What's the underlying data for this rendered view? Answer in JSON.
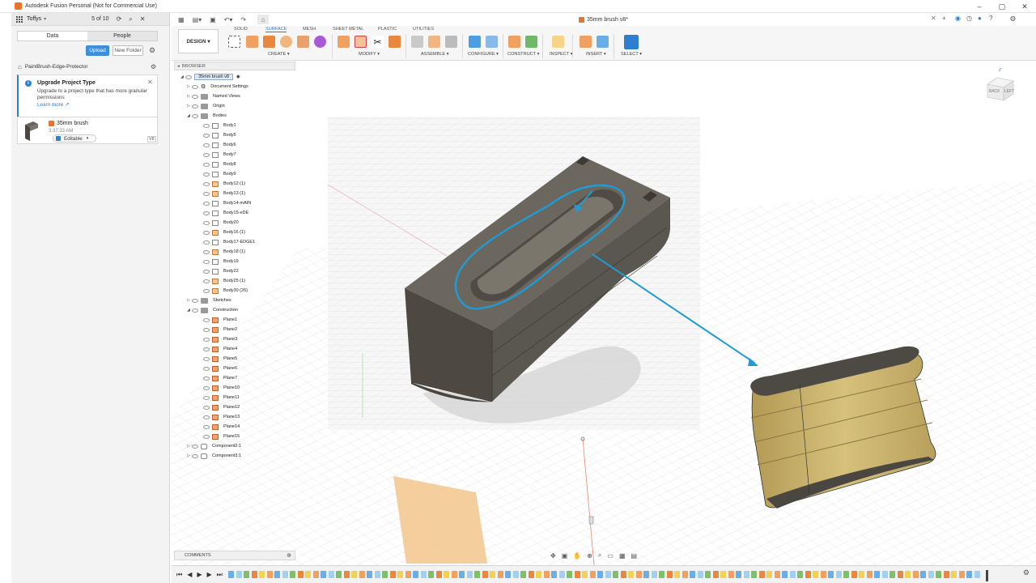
{
  "window": {
    "title": "Autodesk Fusion Personal (Not for Commercial Use)",
    "document_tab": "35mm brush v8*"
  },
  "data_panel": {
    "team": "Toffys",
    "counter": "5 of 10",
    "tabs": [
      "Data",
      "People"
    ],
    "upload_label": "Upload",
    "new_folder_label": "New Folder",
    "breadcrumb": "PaintBrush-Edge-Protector",
    "notice": {
      "title": "Upgrade Project Type",
      "body": "Upgrade to a project type that has more granular permissions",
      "link": "Learn more"
    },
    "file": {
      "name": "35mm brush",
      "time": "3:37:33 AM",
      "status": "Editable",
      "version": "V8"
    }
  },
  "toolbar": {
    "design_label": "DESIGN",
    "workspace_tabs": [
      "SOLID",
      "SURFACE",
      "MESH",
      "SHEET METAL",
      "PLASTIC",
      "UTILITIES"
    ],
    "active_tab": "SURFACE",
    "groups": [
      "CREATE",
      "MODIFY",
      "ASSEMBLE",
      "CONFIGURE",
      "CONSTRUCT",
      "INSPECT",
      "INSERT",
      "SELECT"
    ]
  },
  "browser": {
    "header": "BROWSER",
    "root": "35mm brush v8",
    "nodes": [
      {
        "label": "Document Settings",
        "type": "gear"
      },
      {
        "label": "Named Views",
        "type": "folder"
      },
      {
        "label": "Origin",
        "type": "folder"
      },
      {
        "label": "Bodies",
        "type": "folder"
      }
    ],
    "bodies": [
      {
        "label": "Body1",
        "comp": false
      },
      {
        "label": "Body5",
        "comp": false
      },
      {
        "label": "Body6",
        "comp": false
      },
      {
        "label": "Body7",
        "comp": false
      },
      {
        "label": "Body8",
        "comp": false
      },
      {
        "label": "Body9",
        "comp": false
      },
      {
        "label": "Body12 (1)",
        "comp": true
      },
      {
        "label": "Body13 (1)",
        "comp": true
      },
      {
        "label": "Body14-mAIN",
        "comp": false
      },
      {
        "label": "Body15-eDE",
        "comp": false
      },
      {
        "label": "Body20",
        "comp": false
      },
      {
        "label": "Body16 (1)",
        "comp": true
      },
      {
        "label": "Body17-EDGE1",
        "comp": false
      },
      {
        "label": "Body18 (1)",
        "comp": true
      },
      {
        "label": "Body19",
        "comp": false
      },
      {
        "label": "Body22",
        "comp": false
      },
      {
        "label": "Body25 (1)",
        "comp": true
      },
      {
        "label": "Body30 (26)",
        "comp": true
      }
    ],
    "sketches": "Sketches",
    "construction": "Construction",
    "planes": [
      "Plane1",
      "Plane2",
      "Plane3",
      "Plane4",
      "Plane5",
      "Plane6",
      "Plane7",
      "Plane10",
      "Plane11",
      "Plane12",
      "Plane13",
      "Plane14",
      "Plane15"
    ],
    "components": [
      "Component2:1",
      "Component3:1"
    ]
  },
  "viewcube": {
    "front": "BACK",
    "side": "LEFT",
    "axis": "Z"
  },
  "comments": {
    "label": "COMMENTS"
  },
  "colors": {
    "accent": "#2f7fd0",
    "annotation": "#1f9bd6",
    "body_dark": "#5f5a52",
    "body_tan": "#c7b06a"
  }
}
